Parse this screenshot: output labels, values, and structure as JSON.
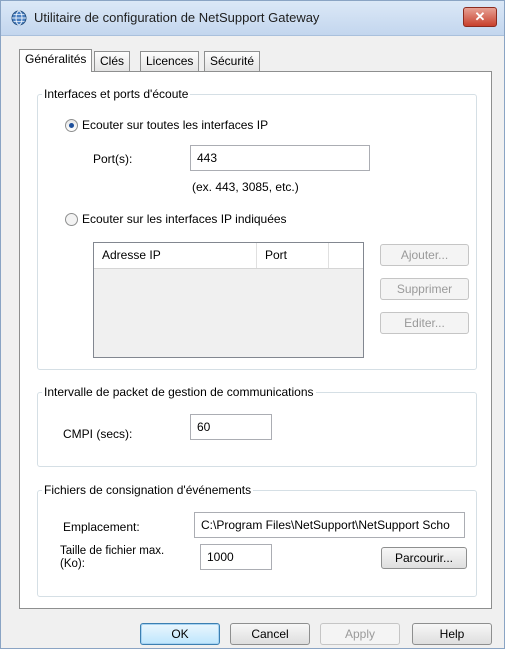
{
  "window": {
    "title": "Utilitaire de configuration de NetSupport Gateway",
    "close_label": "✕"
  },
  "tabs": [
    {
      "label": "Généralités"
    },
    {
      "label": "Clés"
    },
    {
      "label": "Licences"
    },
    {
      "label": "Sécurité"
    }
  ],
  "interfaces": {
    "group_title": "Interfaces et ports d'écoute",
    "radio_all_label": "Ecouter sur toutes les interfaces IP",
    "radio_all_selected": true,
    "ports_label": "Port(s):",
    "ports_value": "443",
    "ports_hint": "(ex. 443, 3085, etc.)",
    "radio_specific_label": "Ecouter sur les interfaces IP indiquées",
    "radio_specific_selected": false,
    "columns": [
      "Adresse IP",
      "Port"
    ],
    "add_button": "Ajouter...",
    "delete_button": "Supprimer",
    "edit_button": "Editer..."
  },
  "cmpi": {
    "group_title": "Intervalle de packet de gestion de communications",
    "label": "CMPI (secs):",
    "value": "60"
  },
  "logs": {
    "group_title": "Fichiers de consignation d'événements",
    "location_label": "Emplacement:",
    "location_value": "C:\\Program Files\\NetSupport\\NetSupport Scho",
    "maxsize_label_line1": "Taille de fichier max.",
    "maxsize_label_line2": "(Ko):",
    "maxsize_value": "1000",
    "browse_button": "Parcourir..."
  },
  "footer": {
    "ok": "OK",
    "cancel": "Cancel",
    "apply": "Apply",
    "help": "Help"
  },
  "icons": {
    "app": "globe-icon",
    "close": "close-icon"
  },
  "colors": {
    "close_button": "#c8402c",
    "default_button": "#3c7fb1",
    "radio_dot": "#1d4f9b"
  }
}
